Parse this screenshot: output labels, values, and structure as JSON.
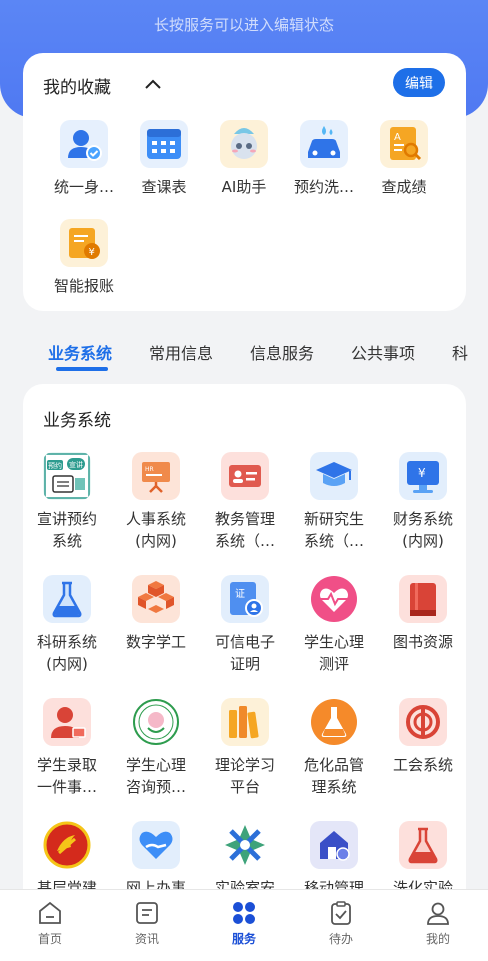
{
  "header": {
    "hint": "长按服务可以进入编辑状态"
  },
  "favorites": {
    "title": "我的收藏",
    "edit_label": "编辑",
    "items": [
      {
        "label": "统一身…",
        "icon": "user-check-icon"
      },
      {
        "label": "查课表",
        "icon": "calendar-grid-icon"
      },
      {
        "label": "AI助手",
        "icon": "ai-robot-icon"
      },
      {
        "label": "预约洗…",
        "icon": "car-wash-icon"
      },
      {
        "label": "查成绩",
        "icon": "grade-search-icon"
      },
      {
        "label": "智能报账",
        "icon": "reimburse-icon"
      }
    ]
  },
  "tabs": [
    {
      "label": "业务系统",
      "active": true
    },
    {
      "label": "常用信息",
      "active": false
    },
    {
      "label": "信息服务",
      "active": false
    },
    {
      "label": "公共事项",
      "active": false
    },
    {
      "label": "科",
      "active": false
    }
  ],
  "business": {
    "title": "业务系统",
    "items": [
      {
        "line1": "宣讲预约",
        "line2": "系统",
        "icon": "lecture-booking-icon"
      },
      {
        "line1": "人事系统",
        "line2": "(内网)",
        "icon": "hr-board-icon"
      },
      {
        "line1": "教务管理",
        "line2": "系统（…",
        "icon": "id-card-icon"
      },
      {
        "line1": "新研究生",
        "line2": "系统（…",
        "icon": "graduate-cap-icon"
      },
      {
        "line1": "财务系统",
        "line2": "(内网)",
        "icon": "finance-monitor-icon"
      },
      {
        "line1": "科研系统",
        "line2": "(内网)",
        "icon": "flask-icon"
      },
      {
        "line1": "数字学工",
        "line2": "",
        "icon": "cubes-icon"
      },
      {
        "line1": "可信电子",
        "line2": "证明",
        "icon": "certificate-icon"
      },
      {
        "line1": "学生心理",
        "line2": "测评",
        "icon": "heart-pulse-icon"
      },
      {
        "line1": "图书资源",
        "line2": "",
        "icon": "book-icon"
      },
      {
        "line1": "学生录取",
        "line2": "一件事…",
        "icon": "student-admission-icon"
      },
      {
        "line1": "学生心理",
        "line2": "咨询预…",
        "icon": "counseling-seal-icon"
      },
      {
        "line1": "理论学习",
        "line2": "平台",
        "icon": "bookshelf-icon"
      },
      {
        "line1": "危化品管",
        "line2": "理系统",
        "icon": "chemical-flask-icon"
      },
      {
        "line1": "工会系统",
        "line2": "",
        "icon": "union-emblem-icon"
      },
      {
        "line1": "基层党建",
        "line2": "",
        "icon": "party-emblem-icon"
      },
      {
        "line1": "网上办事",
        "line2": "",
        "icon": "heart-hand-icon"
      },
      {
        "line1": "实验室安",
        "line2": "",
        "icon": "lab-safety-icon"
      },
      {
        "line1": "移动管理",
        "line2": "",
        "icon": "mobile-home-icon"
      },
      {
        "line1": "洗化实验",
        "line2": "",
        "icon": "test-flask-icon"
      }
    ]
  },
  "nav": [
    {
      "label": "首页",
      "icon": "home-icon",
      "active": false
    },
    {
      "label": "资讯",
      "icon": "news-icon",
      "active": false
    },
    {
      "label": "服务",
      "icon": "services-grid-icon",
      "active": true
    },
    {
      "label": "待办",
      "icon": "todo-clipboard-icon",
      "active": false
    },
    {
      "label": "我的",
      "icon": "profile-icon",
      "active": false
    }
  ],
  "colors": {
    "primary": "#1e6fe8",
    "header": "#5580f4",
    "background": "#f2f3f5"
  }
}
